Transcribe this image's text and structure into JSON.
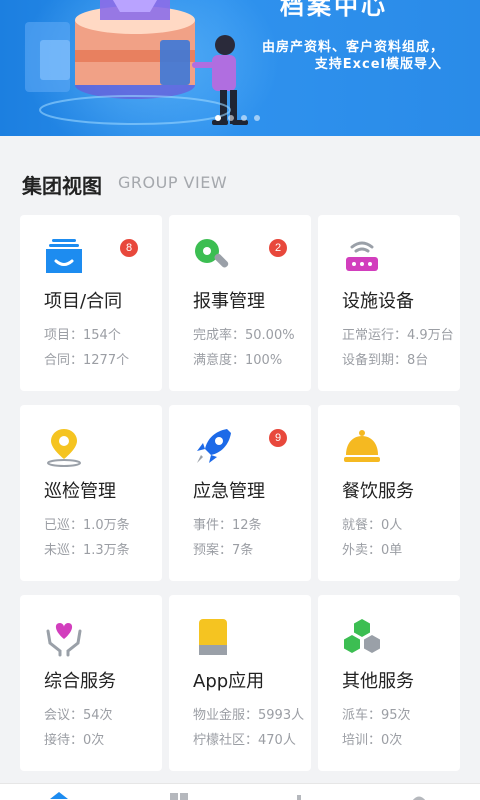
{
  "banner": {
    "title": "档案中心",
    "line1": "由房产资料、客户资料组成，",
    "line2": "支持Excel模版导入",
    "dots_total": 4,
    "dots_active": 1
  },
  "section": {
    "title": "集团视图",
    "subtitle": "GROUP VIEW"
  },
  "cards": [
    {
      "title": "项目/合同",
      "badge": "8",
      "icon": "inbox-icon",
      "stat1": "项目：154个",
      "stat2": "合同：1277个"
    },
    {
      "title": "报事管理",
      "badge": "2",
      "icon": "wrench-icon",
      "stat1": "完成率：50.00%",
      "stat2": "满意度：100%"
    },
    {
      "title": "设施设备",
      "badge": "",
      "icon": "router-icon",
      "stat1": "正常运行：4.9万台",
      "stat2": "设备到期：8台"
    },
    {
      "title": "巡检管理",
      "badge": "",
      "icon": "location-pin-icon",
      "stat1": "已巡：1.0万条",
      "stat2": "未巡：1.3万条"
    },
    {
      "title": "应急管理",
      "badge": "9",
      "icon": "rocket-icon",
      "stat1": "事件：12条",
      "stat2": "预案：7条"
    },
    {
      "title": "餐饮服务",
      "badge": "",
      "icon": "food-cloche-icon",
      "stat1": "就餐：0人",
      "stat2": "外卖：0单"
    },
    {
      "title": "综合服务",
      "badge": "",
      "icon": "heart-hands-icon",
      "stat1": "会议：54次",
      "stat2": "接待：0次"
    },
    {
      "title": "App应用",
      "badge": "",
      "icon": "phone-app-icon",
      "stat1": "物业金服：5993人",
      "stat2": "柠檬社区：470人"
    },
    {
      "title": "其他服务",
      "badge": "",
      "icon": "hexagons-icon",
      "stat1": "派车：95次",
      "stat2": "培训：0次"
    }
  ],
  "colors": {
    "accent": "#2f92ee",
    "badge": "#e8483c",
    "title_text": "#222222",
    "muted_text": "#9b9ea4"
  }
}
